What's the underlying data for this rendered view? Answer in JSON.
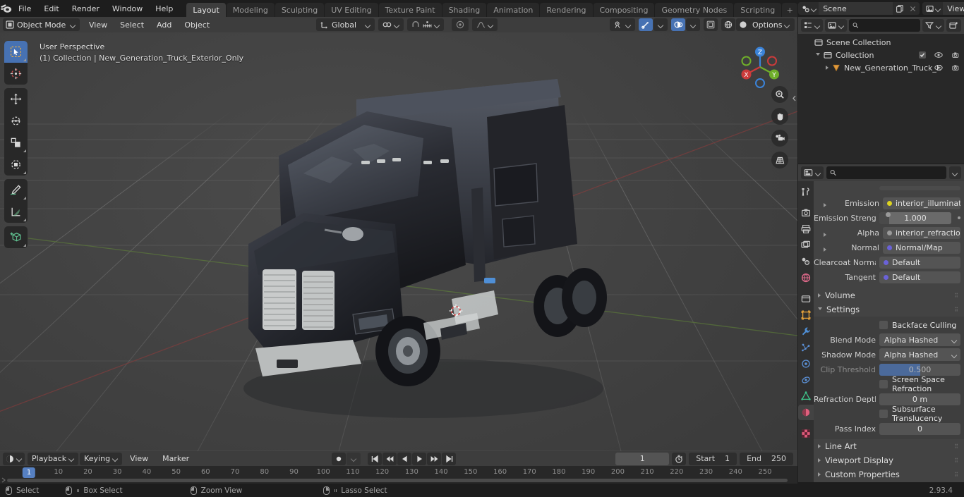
{
  "topbar": {
    "logo_icon": "blender-logo-icon",
    "menus": [
      "File",
      "Edit",
      "Render",
      "Window",
      "Help"
    ],
    "workspaces": [
      {
        "label": "Layout",
        "active": true
      },
      {
        "label": "Modeling",
        "active": false
      },
      {
        "label": "Sculpting",
        "active": false
      },
      {
        "label": "UV Editing",
        "active": false
      },
      {
        "label": "Texture Paint",
        "active": false
      },
      {
        "label": "Shading",
        "active": false
      },
      {
        "label": "Animation",
        "active": false
      },
      {
        "label": "Rendering",
        "active": false
      },
      {
        "label": "Compositing",
        "active": false
      },
      {
        "label": "Geometry Nodes",
        "active": false
      },
      {
        "label": "Scripting",
        "active": false
      }
    ],
    "add_workspace_label": "+",
    "scene": {
      "name": "Scene",
      "browse_icon": "scene-browse-icon",
      "new_icon": "copy-icon",
      "unlink_icon": "close-icon"
    },
    "view_layer": {
      "name": "View Layer",
      "browse_icon": "viewlayer-browse-icon",
      "new_icon": "copy-icon",
      "unlink_icon": "close-icon"
    }
  },
  "viewport_header": {
    "mode": "Object Mode",
    "menus": [
      "View",
      "Select",
      "Add",
      "Object"
    ],
    "transform_orientation": "Global",
    "snap_icon": "magnet-icon",
    "proportional_icon": "proportional-edit-icon",
    "options_label": "Options",
    "shading_modes": [
      "wireframe",
      "solid",
      "material-preview",
      "rendered"
    ],
    "active_shading": "material-preview"
  },
  "viewport": {
    "perspective_label": "User Perspective",
    "scene_path": "(1) Collection | New_Generation_Truck_Exterior_Only",
    "gizmo_axes": [
      "X",
      "Y",
      "Z"
    ],
    "nav_buttons": [
      "zoom-icon",
      "hand-icon",
      "camera-icon",
      "grid-icon"
    ],
    "toolbar_tools": [
      {
        "name": "tweak-select-tool",
        "active": true
      },
      {
        "name": "cursor-tool",
        "active": false
      },
      {
        "name": "move-tool",
        "active": false
      },
      {
        "name": "rotate-tool",
        "active": false
      },
      {
        "name": "scale-tool",
        "active": false
      },
      {
        "name": "transform-tool",
        "active": false
      },
      {
        "name": "annotate-tool",
        "active": false
      },
      {
        "name": "measure-tool",
        "active": false
      },
      {
        "name": "add-cube-tool",
        "active": false
      }
    ],
    "colors": {
      "axis_x": "#a33b3b",
      "axis_y": "#6b9a35",
      "accent": "#4772b3"
    }
  },
  "outliner": {
    "display_mode_icon": "outliner-icon",
    "filter_icon": "filter-icon",
    "new_collection_icon": "new-collection-icon",
    "search_placeholder": "",
    "rows": [
      {
        "label": "Scene Collection",
        "icon": "collection-icon",
        "indent": 0,
        "expander": "none",
        "has_toggles": false
      },
      {
        "label": "Collection",
        "icon": "collection-icon",
        "indent": 1,
        "expander": "down",
        "has_toggles": true,
        "checkbox": true
      },
      {
        "label": "New_Generation_Truck_E",
        "icon": "mesh-object-icon",
        "indent": 2,
        "expander": "right",
        "has_toggles": true,
        "checkbox": false
      }
    ]
  },
  "properties": {
    "editor_icon": "properties-editor-icon",
    "search_placeholder": "",
    "tabs": [
      {
        "name": "tool-tab",
        "icon": "tool-icon",
        "color": "#c8c8c8",
        "active": false
      },
      {
        "name": "render-tab",
        "icon": "camera-back-icon",
        "color": "#c8c8c8",
        "active": false,
        "gap": true
      },
      {
        "name": "output-tab",
        "icon": "printer-icon",
        "color": "#c8c8c8",
        "active": false
      },
      {
        "name": "view-layer-tab",
        "icon": "images-icon",
        "color": "#c8c8c8",
        "active": false
      },
      {
        "name": "scene-tab",
        "icon": "scene-icon",
        "color": "#c8c8c8",
        "active": false
      },
      {
        "name": "world-tab",
        "icon": "world-icon",
        "color": "#e06a8b",
        "active": false
      },
      {
        "name": "collection-tab",
        "icon": "collection-icon",
        "color": "#c8c8c8",
        "active": false,
        "gap": true
      },
      {
        "name": "object-tab",
        "icon": "object-icon",
        "color": "#e9a33a",
        "active": false
      },
      {
        "name": "modifier-tab",
        "icon": "wrench-icon",
        "color": "#4f8fd6",
        "active": false
      },
      {
        "name": "particles-tab",
        "icon": "particles-icon",
        "color": "#5b90d6",
        "active": false
      },
      {
        "name": "physics-tab",
        "icon": "physics-icon",
        "color": "#5b90d6",
        "active": false
      },
      {
        "name": "constraints-tab",
        "icon": "constraints-icon",
        "color": "#5b90d6",
        "active": false
      },
      {
        "name": "data-tab",
        "icon": "mesh-data-icon",
        "color": "#3fc48a",
        "active": false
      },
      {
        "name": "material-tab",
        "icon": "material-icon",
        "color": "#e0607e",
        "active": true
      },
      {
        "name": "texture-tab",
        "icon": "texture-icon",
        "color": "#e05a7a",
        "active": false,
        "gap": true
      }
    ],
    "node_inputs": [
      {
        "label": "Emission",
        "value": "interior_illumination...",
        "socket": "#dcd320",
        "expander": true
      },
      {
        "label": "Emission Strengt",
        "value": "1.000",
        "socket": "#9a9a9a",
        "expander": false,
        "is_value": true
      },
      {
        "label": "Alpha",
        "value": "interior_refraction_in...",
        "socket": "#9a9a9a",
        "expander": true
      },
      {
        "label": "Normal",
        "value": "Normal/Map",
        "socket": "#6a62d8",
        "expander": true
      },
      {
        "label": "Clearcoat Normal",
        "value": "Default",
        "socket": "#6a62d8",
        "expander": false
      },
      {
        "label": "Tangent",
        "value": "Default",
        "socket": "#6a62d8",
        "expander": false
      }
    ],
    "sections": [
      {
        "label": "Volume",
        "open": false
      },
      {
        "label": "Settings",
        "open": true
      }
    ],
    "settings": {
      "backface_culling": {
        "label": "Backface Culling",
        "checked": false
      },
      "blend_mode": {
        "label": "Blend Mode",
        "value": "Alpha Hashed"
      },
      "shadow_mode": {
        "label": "Shadow Mode",
        "value": "Alpha Hashed"
      },
      "clip_threshold": {
        "label": "Clip Threshold",
        "value": "0.500",
        "fill_pct": 50,
        "disabled": true
      },
      "screen_space_refraction": {
        "label": "Screen Space Refraction",
        "checked": false
      },
      "refraction_depth": {
        "label": "Refraction Depth",
        "value": "0 m"
      },
      "subsurface_translucency": {
        "label": "Subsurface Translucency",
        "checked": false
      },
      "pass_index": {
        "label": "Pass Index",
        "value": "0"
      }
    },
    "bottom_sections": [
      {
        "label": "Line Art",
        "open": false
      },
      {
        "label": "Viewport Display",
        "open": false
      },
      {
        "label": "Custom Properties",
        "open": false
      }
    ]
  },
  "timeline": {
    "editor_icon": "timeline-editor-icon",
    "menus": [
      "Playback",
      "Keying",
      "View",
      "Marker"
    ],
    "record_icon": "record-icon",
    "transport": [
      "jump-start-icon",
      "prev-keyframe-icon",
      "play-reverse-icon",
      "play-icon",
      "next-keyframe-icon",
      "jump-end-icon"
    ],
    "current_frame": "1",
    "use_preview_icon": "stopwatch-icon",
    "start_label": "Start",
    "start_value": "1",
    "end_label": "End",
    "end_value": "250",
    "playhead_frame": "1",
    "ticks": [
      10,
      20,
      30,
      40,
      50,
      60,
      70,
      80,
      90,
      100,
      110,
      120,
      130,
      140,
      150,
      160,
      170,
      180,
      190,
      200,
      210,
      220,
      230,
      240,
      250
    ]
  },
  "statusbar": {
    "hints": [
      {
        "label": "Select",
        "mouse": "left"
      },
      {
        "label": "Box Select",
        "mouse": "left-drag"
      },
      {
        "label": "Zoom View",
        "mouse": "middle"
      },
      {
        "label": "Lasso Select",
        "mouse": "right-drag"
      }
    ],
    "version": "2.93.4"
  }
}
